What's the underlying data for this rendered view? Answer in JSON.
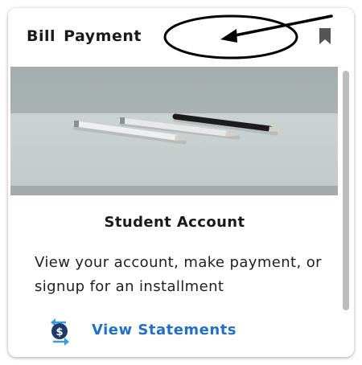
{
  "card": {
    "title": "Bill Payment",
    "account_title": "Student Account",
    "description": "View your account, make payment, or signup for an installment",
    "link_label": "View Statements",
    "icons": {
      "bookmark": "bookmark-icon",
      "statements": "dollar-exchange-icon"
    },
    "image": "photo of pencils on a gray desk"
  },
  "colors": {
    "link": "#2470c6",
    "icon_dark": "#1e3a66",
    "icon_arrows": "#3a9be0",
    "bookmark": "#555555"
  }
}
